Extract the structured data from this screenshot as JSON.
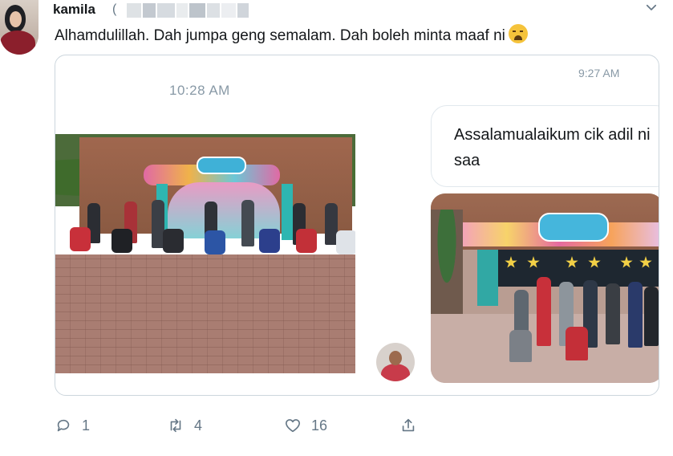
{
  "author": {
    "name": "kamila",
    "handle_prefix": "("
  },
  "tweet": {
    "text": "Alhamdulillah. Dah jumpa geng semalam. Dah boleh minta maaf ni",
    "emoji": "loudly-crying-face-emoji"
  },
  "card": {
    "time_left": "10:28 AM",
    "time_right": "9:27 AM",
    "message": "Assalamualaikum cik adil ni saa"
  },
  "actions": {
    "reply_count": "1",
    "retweet_count": "4",
    "like_count": "16"
  },
  "colors": {
    "text_primary": "#14171a",
    "text_secondary": "#657786",
    "timestamp": "#8899a6",
    "border": "#ccd6dd"
  },
  "icons": {
    "reply": "reply-icon",
    "retweet": "retweet-icon",
    "like": "heart-icon",
    "share": "share-icon",
    "menu": "chevron-down-icon"
  }
}
